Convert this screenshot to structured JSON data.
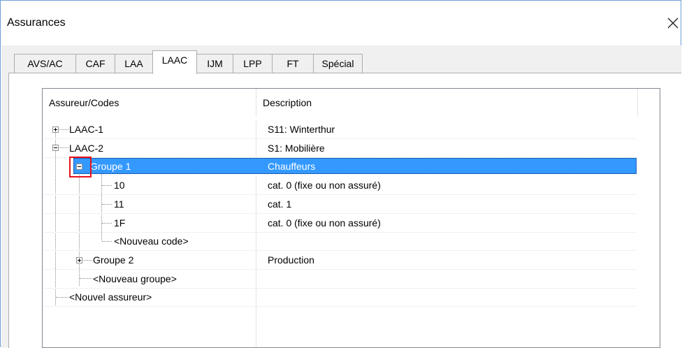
{
  "window": {
    "title": "Assurances"
  },
  "tabs": [
    {
      "label": "AVS/AC",
      "active": false
    },
    {
      "label": "CAF",
      "active": false
    },
    {
      "label": "LAA",
      "active": false
    },
    {
      "label": "LAAC",
      "active": true
    },
    {
      "label": "IJM",
      "active": false
    },
    {
      "label": "LPP",
      "active": false
    },
    {
      "label": "FT",
      "active": false
    },
    {
      "label": "Spécial",
      "active": false
    }
  ],
  "list": {
    "columns": [
      "Assureur/Codes",
      "Description"
    ],
    "rows": [
      {
        "label": "LAAC-1",
        "description": "S11: Winterthur",
        "expander": "collapsed"
      },
      {
        "label": "LAAC-2",
        "description": "S1: Mobilière",
        "expander": "expanded"
      },
      {
        "label": "Groupe 1",
        "description": "Chauffeurs",
        "expander": "expanded",
        "selected": true
      },
      {
        "label": "10",
        "description": "cat. 0 (fixe ou non assuré)"
      },
      {
        "label": "11",
        "description": "cat. 1"
      },
      {
        "label": "1F",
        "description": "cat. 0 (fixe ou non assuré)"
      },
      {
        "label": "<Nouveau code>",
        "description": ""
      },
      {
        "label": "Groupe 2",
        "description": "Production",
        "expander": "collapsed"
      },
      {
        "label": "<Nouveau groupe>",
        "description": ""
      },
      {
        "label": "<Nouvel assureur>",
        "description": ""
      }
    ]
  },
  "icons": {
    "close": "close-icon",
    "expand": "plus-box-icon",
    "collapse": "minus-box-icon"
  },
  "colors": {
    "selection": "#3399ff",
    "highlight_box": "#e8101c",
    "window_border": "#6e9fd8"
  }
}
